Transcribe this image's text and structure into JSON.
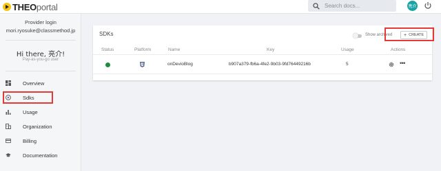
{
  "app": {
    "logo_bold": "THEO",
    "logo_light": "portal"
  },
  "topbar": {
    "search_placeholder": "Search docs...",
    "avatar_text": "亮介"
  },
  "sidebar": {
    "provider_title": "Provider login",
    "provider_email": "mori.ryosuke@classmethod.jp",
    "greeting": "Hi there, 亮介!",
    "plan": "Pay-as-you-go user",
    "items": [
      {
        "label": "Overview",
        "icon": "dashboard-icon"
      },
      {
        "label": "Sdks",
        "icon": "play-circle-icon"
      },
      {
        "label": "Usage",
        "icon": "bar-chart-icon"
      },
      {
        "label": "Organization",
        "icon": "building-icon"
      },
      {
        "label": "Billing",
        "icon": "credit-card-icon"
      },
      {
        "label": "Documentation",
        "icon": "school-icon"
      }
    ]
  },
  "panel": {
    "title": "SDKs",
    "show_archived": "Show archived",
    "create_label": "CREATE",
    "columns": [
      "Status",
      "Platform",
      "Name",
      "Key",
      "Usage",
      "Actions"
    ],
    "rows": [
      {
        "status": "active",
        "platform": "html5-icon",
        "name": "onDevioBlog",
        "key": "b907a379-fb6a-4fe2-9b03-9fd76449216b",
        "usage": "5"
      }
    ]
  },
  "colors": {
    "accent_teal": "#1aa3a3",
    "status_green": "#1e8e3e",
    "highlight_red": "#e53935",
    "logo_yellow": "#f5c518"
  }
}
